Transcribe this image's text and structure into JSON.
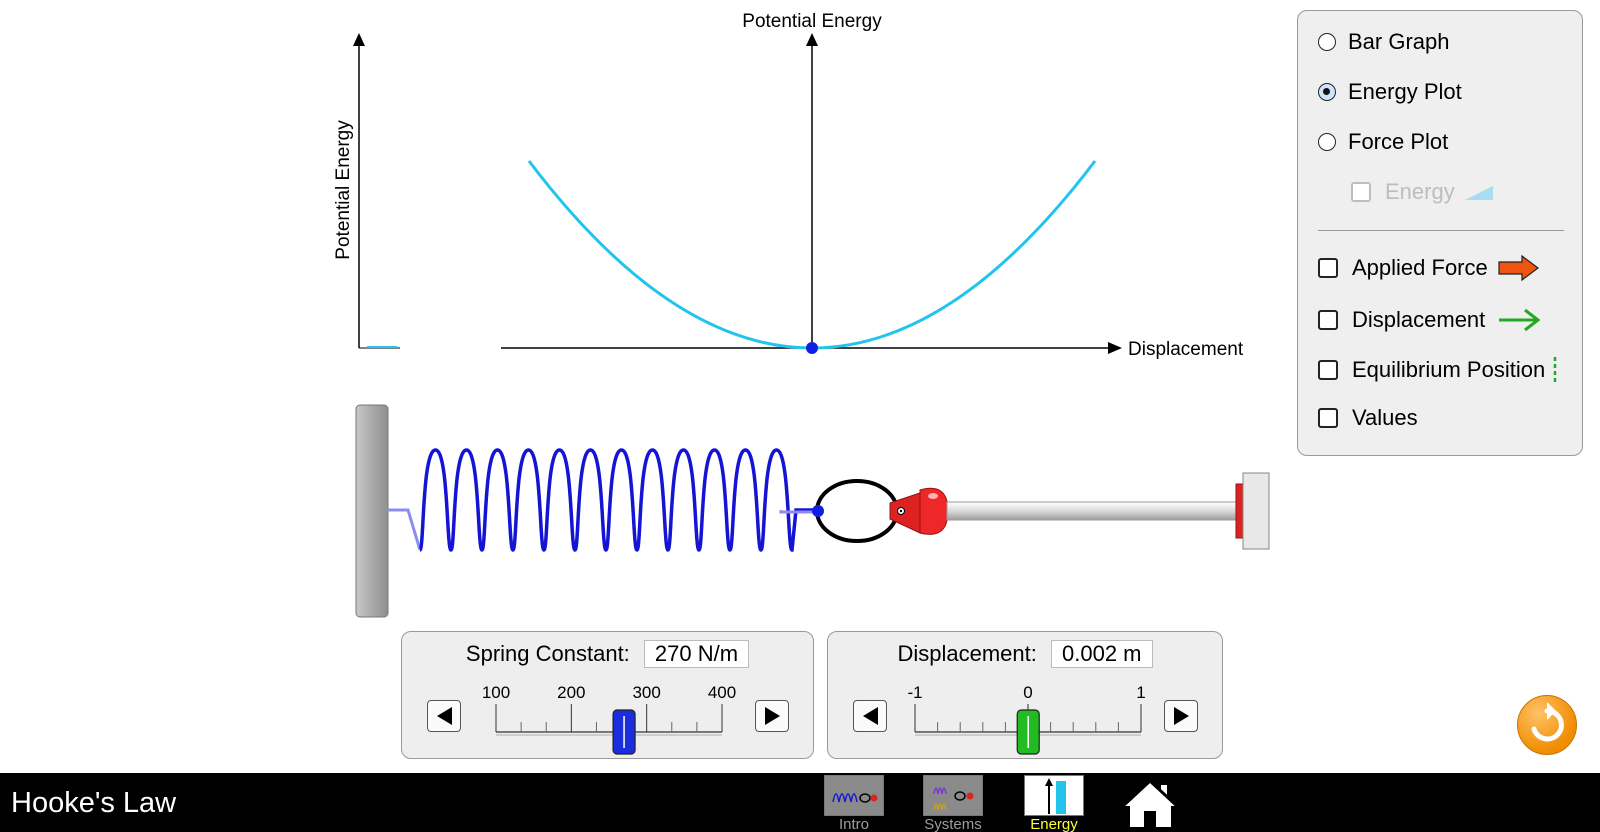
{
  "app": {
    "title": "Hooke's Law"
  },
  "plot": {
    "title": "Potential Energy",
    "axis_y_label": "Potential Energy",
    "axis_x_label": "Displacement",
    "curve_color": "#22c4ee"
  },
  "panel": {
    "view_options": [
      {
        "label": "Bar Graph",
        "selected": false
      },
      {
        "label": "Energy Plot",
        "selected": true
      },
      {
        "label": "Force Plot",
        "selected": false
      }
    ],
    "energy_sub_option": {
      "label": "Energy",
      "checked": false,
      "disabled": true
    },
    "checkboxes": [
      {
        "label": "Applied Force",
        "checked": false,
        "icon": "applied-force-arrow-icon",
        "color": "#ee5511"
      },
      {
        "label": "Displacement",
        "checked": false,
        "icon": "displacement-arrow-icon",
        "color": "#22aa22"
      },
      {
        "label": "Equilibrium Position",
        "checked": false,
        "icon": "equilibrium-line-icon",
        "color": "#22aa22"
      },
      {
        "label": "Values",
        "checked": false
      }
    ]
  },
  "spring_constant": {
    "label": "Spring Constant:",
    "value": "270 N/m",
    "ticks": [
      "100",
      "200",
      "300",
      "400"
    ],
    "min": 100,
    "max": 400,
    "current": 270,
    "thumb_color": "#1a2ee0"
  },
  "displacement": {
    "label": "Displacement:",
    "value": "0.002 m",
    "ticks": [
      "-1",
      "0",
      "1"
    ],
    "min": -1,
    "max": 1,
    "current": 0.002,
    "thumb_color": "#22bb22"
  },
  "nav": {
    "tabs": [
      {
        "label": "Intro",
        "active": false
      },
      {
        "label": "Systems",
        "active": false
      },
      {
        "label": "Energy",
        "active": true
      }
    ],
    "home": "home-icon"
  }
}
